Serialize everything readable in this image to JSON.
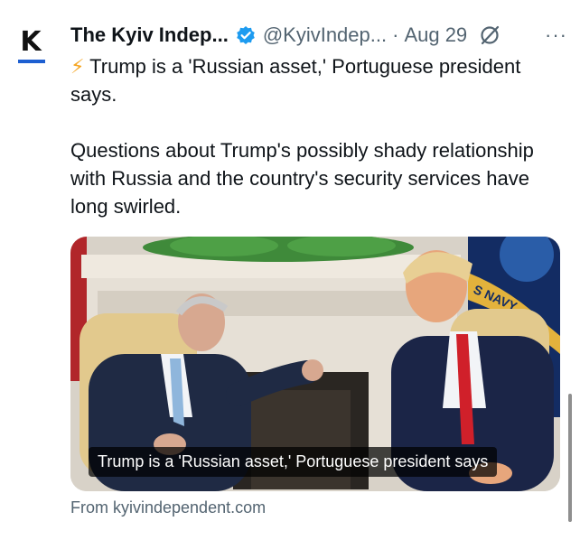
{
  "account": {
    "avatar_letter": "K",
    "name": "The Kyiv Indep...",
    "handle": "@KyivIndep...",
    "separator": "·",
    "date": "Aug 29",
    "more_label": "···"
  },
  "tweet": {
    "emoji": "⚡",
    "headline": "Trump is a 'Russian asset,' Portuguese president says.",
    "paragraph": "Questions about Trump's possibly shady relationship with Russia and the country's security services have long swirled."
  },
  "card": {
    "caption": "Trump is a 'Russian asset,' Portuguese president says",
    "flag_text": "S NAVY",
    "source": "From kyivindependent.com"
  },
  "colors": {
    "verified": "#1d9bf0",
    "avatar_underline": "#1d5fd1",
    "secondary_text": "#536471",
    "tie_red": "#d0202a",
    "tie_blue": "#8fb6dc",
    "navy_flag": "#132c63"
  },
  "icons": {
    "verified": "verified-badge-icon",
    "grok": "grok-icon",
    "more": "more-icon",
    "bolt": "lightning-bolt-icon"
  }
}
